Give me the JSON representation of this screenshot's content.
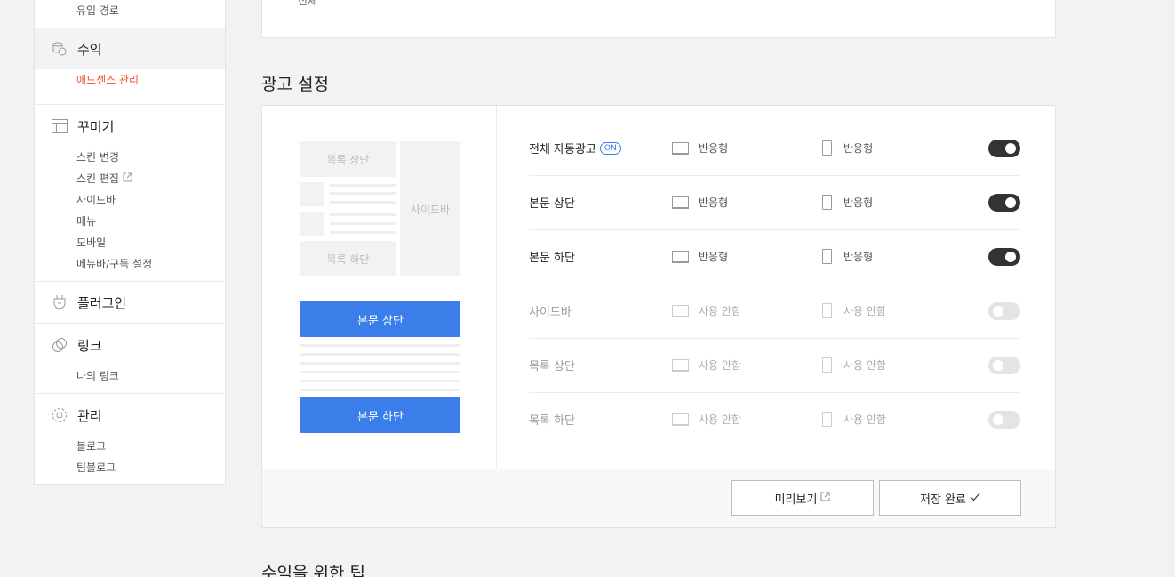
{
  "sidebar": {
    "top_item": "유입 경로",
    "revenue": {
      "title": "수익",
      "items": [
        "애드센스 관리"
      ]
    },
    "decorate": {
      "title": "꾸미기",
      "items": [
        "스킨 변경",
        "스킨 편집",
        "사이드바",
        "메뉴",
        "모바일",
        "메뉴바/구독 설정"
      ]
    },
    "plugin": {
      "title": "플러그인"
    },
    "link": {
      "title": "링크",
      "items": [
        "나의 링크"
      ]
    },
    "manage": {
      "title": "관리",
      "items": [
        "블로그",
        "팀블로그"
      ]
    }
  },
  "top_table": {
    "row_label": "전체"
  },
  "ad_settings": {
    "title": "광고 설정",
    "preview": {
      "list_top": "목록 상단",
      "list_bottom": "목록 하단",
      "sidebar": "사이드바",
      "body_top": "본문 상단",
      "body_bottom": "본문 하단"
    },
    "on_badge": "ON",
    "rows": [
      {
        "name": "전체 자동광고",
        "pc": "반응형",
        "mobile": "반응형",
        "enabled": true
      },
      {
        "name": "본문 상단",
        "pc": "반응형",
        "mobile": "반응형",
        "enabled": true
      },
      {
        "name": "본문 하단",
        "pc": "반응형",
        "mobile": "반응형",
        "enabled": true
      },
      {
        "name": "사이드바",
        "pc": "사용 안함",
        "mobile": "사용 안함",
        "enabled": false
      },
      {
        "name": "목록 상단",
        "pc": "사용 안함",
        "mobile": "사용 안함",
        "enabled": false
      },
      {
        "name": "목록 하단",
        "pc": "사용 안함",
        "mobile": "사용 안함",
        "enabled": false
      }
    ],
    "preview_button": "미리보기",
    "save_button": "저장 완료"
  },
  "tips_title": "수익을 위한 팁",
  "colors": {
    "accent": "#3b7de9",
    "active_menu": "#f14e2e",
    "toggle_on": "#333333"
  }
}
